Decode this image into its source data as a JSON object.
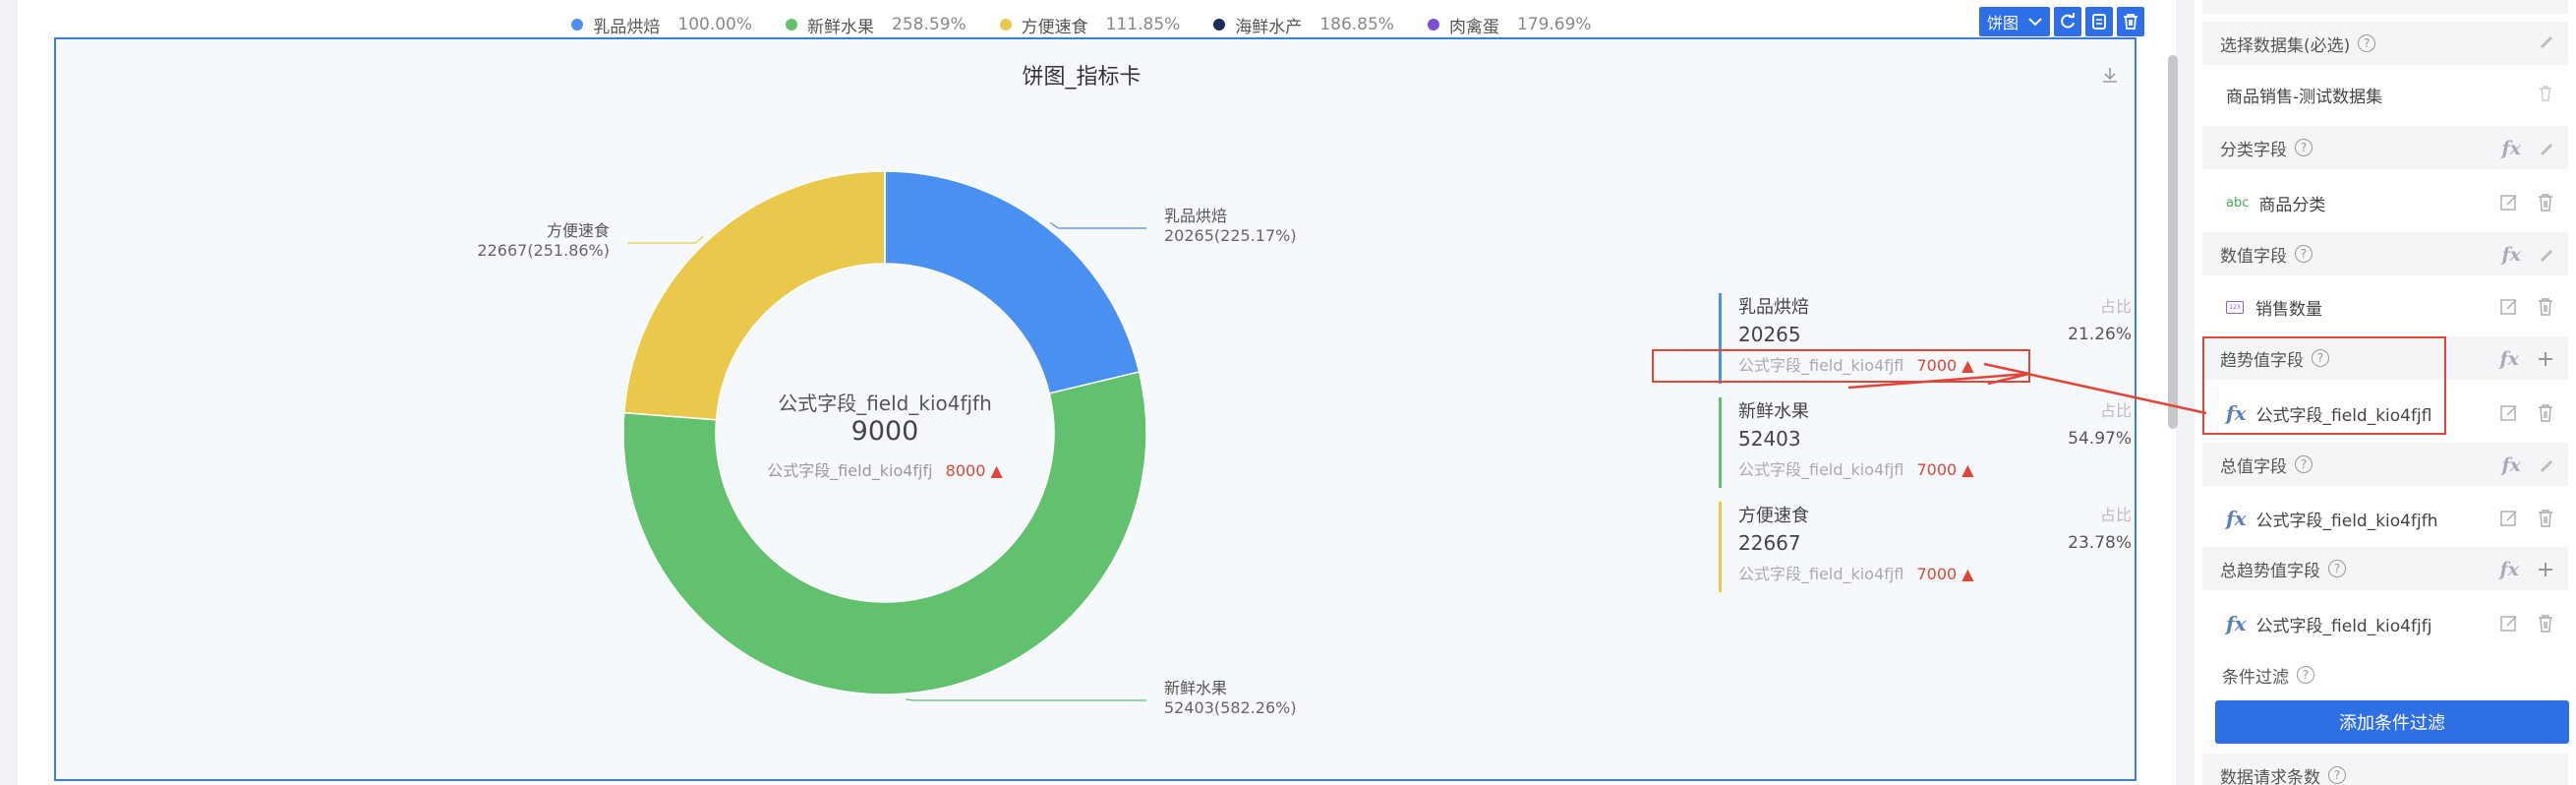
{
  "legend": [
    {
      "name": "乳品烘焙",
      "pct": "100.00%",
      "color": "#4a90f0"
    },
    {
      "name": "新鲜水果",
      "pct": "258.59%",
      "color": "#62c16e"
    },
    {
      "name": "方便速食",
      "pct": "111.85%",
      "color": "#e9c84b"
    },
    {
      "name": "海鲜水产",
      "pct": "186.85%",
      "color": "#1c2d5a"
    },
    {
      "name": "肉禽蛋",
      "pct": "179.69%",
      "color": "#7b4fd6"
    }
  ],
  "toolbar": {
    "chart_type_label": "饼图"
  },
  "widget": {
    "title": "饼图_指标卡"
  },
  "chart_data": {
    "type": "pie",
    "title": "饼图_指标卡",
    "donut": true,
    "slices": [
      {
        "name": "乳品烘焙",
        "value": 20265,
        "label": "20265(225.17%)",
        "color": "#4a90f0"
      },
      {
        "name": "新鲜水果",
        "value": 52403,
        "label": "52403(582.26%)",
        "color": "#62c16e"
      },
      {
        "name": "方便速食",
        "value": 22667,
        "label": "22667(251.86%)",
        "color": "#e9c84b"
      }
    ],
    "center": {
      "name": "公式字段_field_kio4fjfh",
      "value": "9000",
      "trend_label": "公式字段_field_kio4fjfj",
      "trend_value": "8000 ▲"
    }
  },
  "cards": [
    {
      "name": "乳品烘焙",
      "value": "20265",
      "trend_label": "公式字段_field_kio4fjfl",
      "trend_value": "7000 ▲",
      "share_label": "占比",
      "share": "21.26%",
      "color": "#4a90f0"
    },
    {
      "name": "新鲜水果",
      "value": "52403",
      "trend_label": "公式字段_field_kio4fjfl",
      "trend_value": "7000 ▲",
      "share_label": "占比",
      "share": "54.97%",
      "color": "#62c16e"
    },
    {
      "name": "方便速食",
      "value": "22667",
      "trend_label": "公式字段_field_kio4fjfl",
      "trend_value": "7000 ▲",
      "share_label": "占比",
      "share": "23.78%",
      "color": "#e9c84b"
    }
  ],
  "panel": {
    "dataset_header": "选择数据集(必选)",
    "dataset_value": "商品销售-测试数据集",
    "category_header": "分类字段",
    "category_value": "商品分类",
    "category_tag": "abc",
    "value_header": "数值字段",
    "value_value": "销售数量",
    "trend_header": "趋势值字段",
    "trend_value": "公式字段_field_kio4fjfl",
    "total_header": "总值字段",
    "total_value": "公式字段_field_kio4fjfh",
    "total_trend_header": "总趋势值字段",
    "total_trend_value": "公式字段_field_kio4fjfj",
    "filter_header": "条件过滤",
    "add_filter_label": "添加条件过滤",
    "request_header": "数据请求条数"
  }
}
